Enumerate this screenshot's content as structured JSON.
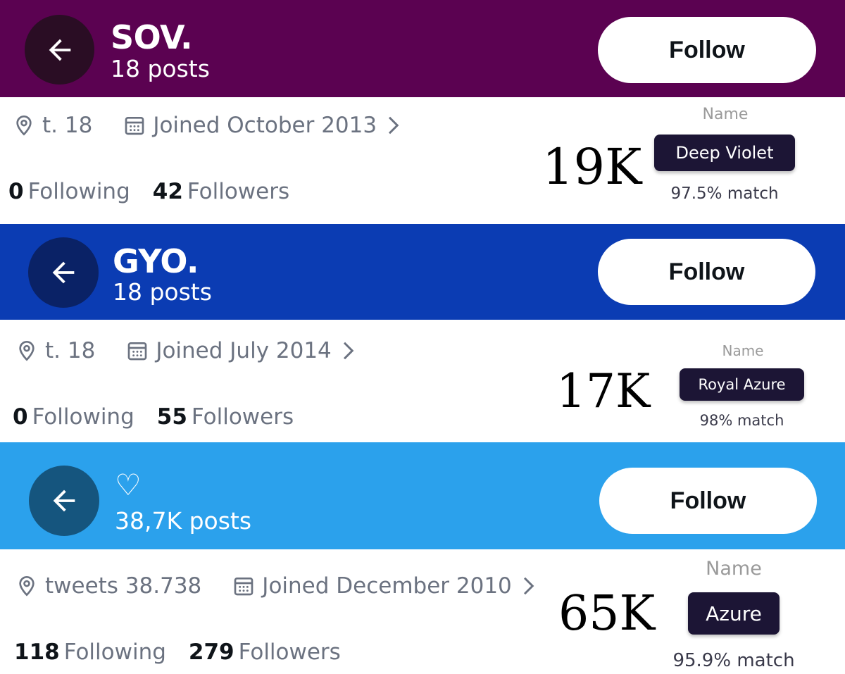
{
  "profiles": [
    {
      "banner_color": "#5b0251",
      "back_color": "#2a0d24",
      "title": "SOV.",
      "posts": "18 posts",
      "follow_label": "Follow",
      "location": "t. 18",
      "joined": "Joined October 2013",
      "following_count": "0",
      "following_label": "Following",
      "followers_count": "42",
      "followers_label": "Followers",
      "overlay_count": "19K",
      "name_label": "Name",
      "color_name": "Deep Violet",
      "match": "97.5% match"
    },
    {
      "banner_color": "#0b3cb3",
      "back_color": "#0a2266",
      "title": "GYO.",
      "posts": "18 posts",
      "follow_label": "Follow",
      "location": "t. 18",
      "joined": "Joined July 2014",
      "following_count": "0",
      "following_label": "Following",
      "followers_count": "55",
      "followers_label": "Followers",
      "overlay_count": "17K",
      "name_label": "Name",
      "color_name": "Royal Azure",
      "match": "98% match"
    },
    {
      "banner_color": "#2ba1ec",
      "back_color": "#15557e",
      "title": "♡",
      "posts": "38,7K posts",
      "follow_label": "Follow",
      "location": "tweets 38.738",
      "joined": "Joined December 2010",
      "following_count": "118",
      "following_label": "Following",
      "followers_count": "279",
      "followers_label": "Followers",
      "overlay_count": "65K",
      "name_label": "Name",
      "color_name": "Azure",
      "match": "95.9% match"
    }
  ]
}
